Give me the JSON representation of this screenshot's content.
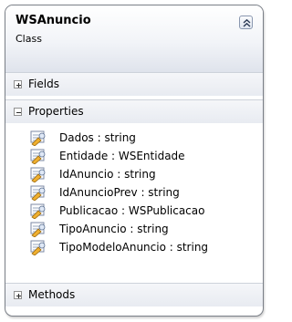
{
  "class": {
    "name": "WSAnuncio",
    "kind": "Class",
    "collapse_icon": "double-chevron-up-icon"
  },
  "sections": {
    "fields": {
      "label": "Fields",
      "state": "collapsed"
    },
    "properties": {
      "label": "Properties",
      "state": "expanded"
    },
    "methods": {
      "label": "Methods",
      "state": "collapsed"
    }
  },
  "properties": [
    {
      "text": "Dados : string",
      "icon": "property-icon"
    },
    {
      "text": "Entidade : WSEntidade",
      "icon": "property-icon"
    },
    {
      "text": "IdAnuncio : string",
      "icon": "property-icon"
    },
    {
      "text": "IdAnuncioPrev : string",
      "icon": "property-icon"
    },
    {
      "text": "Publicacao : WSPublicacao",
      "icon": "property-icon"
    },
    {
      "text": "TipoAnuncio : string",
      "icon": "property-icon"
    },
    {
      "text": "TipoModeloAnuncio : string",
      "icon": "property-icon"
    }
  ],
  "colors": {
    "border": "#7a7f87",
    "header_gradient_end": "#dfe3ec",
    "section_bar": "#e8ebf1",
    "icon_accent": "#e0a030"
  }
}
